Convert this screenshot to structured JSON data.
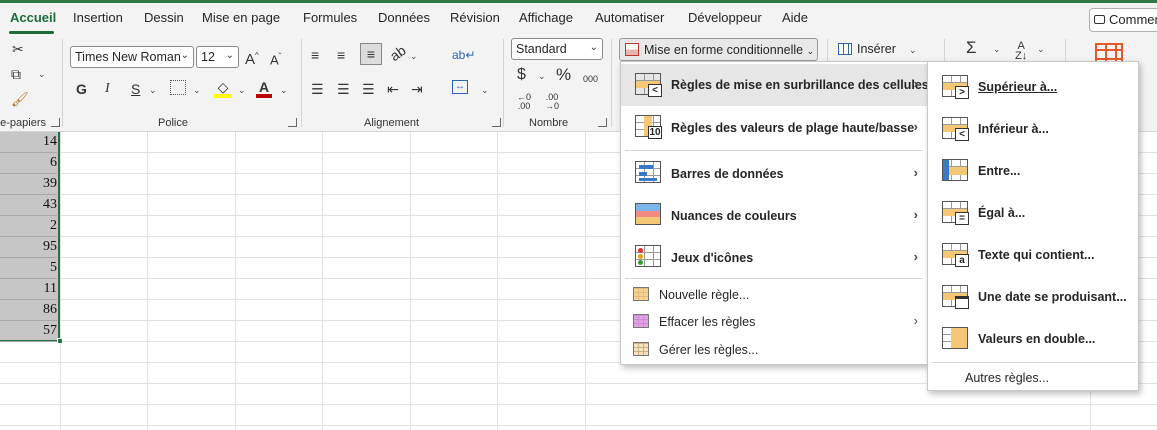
{
  "tabs": [
    "Accueil",
    "Insertion",
    "Dessin",
    "Mise en page",
    "Formules",
    "Données",
    "Révision",
    "Affichage",
    "Automatiser",
    "Développeur",
    "Aide"
  ],
  "comment_button": "Commentaires",
  "ribbon": {
    "clipboard_label": "Presse-papiers",
    "font_group_label": "Police",
    "font_name": "Times New Roman",
    "font_size": "12",
    "bold": "G",
    "italic": "I",
    "underline": "S",
    "alignment_label": "Alignement",
    "number_format": "Standard",
    "currency": "$",
    "percent": "%",
    "thousands": "000",
    "dec_increase": "←0 .00",
    "dec_decrease": ".00 →0",
    "number_label": "Nombre",
    "conditional_formatting": "Mise en forme conditionnelle",
    "insert": "Insérer",
    "sum_icon": "Σ"
  },
  "cells": [
    "14",
    "6",
    "39",
    "43",
    "2",
    "95",
    "5",
    "11",
    "86",
    "57"
  ],
  "menu_main": {
    "items": [
      {
        "label": "Règles de mise en surbrillance des cellules",
        "badge": "<",
        "submenu": true
      },
      {
        "label": "Règles des valeurs de plage haute/basse",
        "badge": "10",
        "submenu": true
      },
      {
        "label": "Barres de données",
        "submenu": true
      },
      {
        "label": "Nuances de couleurs",
        "submenu": true
      },
      {
        "label": "Jeux d'icônes",
        "submenu": true
      }
    ],
    "small_items": [
      {
        "label": "Nouvelle règle...",
        "submenu": false
      },
      {
        "label": "Effacer les règles",
        "submenu": true
      },
      {
        "label": "Gérer les règles...",
        "submenu": false
      }
    ]
  },
  "menu_sub": {
    "items": [
      {
        "label": "Supérieur à...",
        "badge": ">"
      },
      {
        "label": "Inférieur à...",
        "badge": "<"
      },
      {
        "label": "Entre...",
        "badge": ""
      },
      {
        "label": "Égal à...",
        "badge": "="
      },
      {
        "label": "Texte qui contient...",
        "badge": "a"
      },
      {
        "label": "Une date se produisant...",
        "badge": ""
      },
      {
        "label": "Valeurs en double...",
        "badge": ""
      }
    ],
    "more": "Autres règles..."
  },
  "submenu_arrow": "›",
  "colors": {
    "accent": "#1e6b3a",
    "selection_border": "#217346",
    "highlight_orange": "#f5c878",
    "font_color_red": "#c00000",
    "fill_yellow": "#ffff00"
  }
}
